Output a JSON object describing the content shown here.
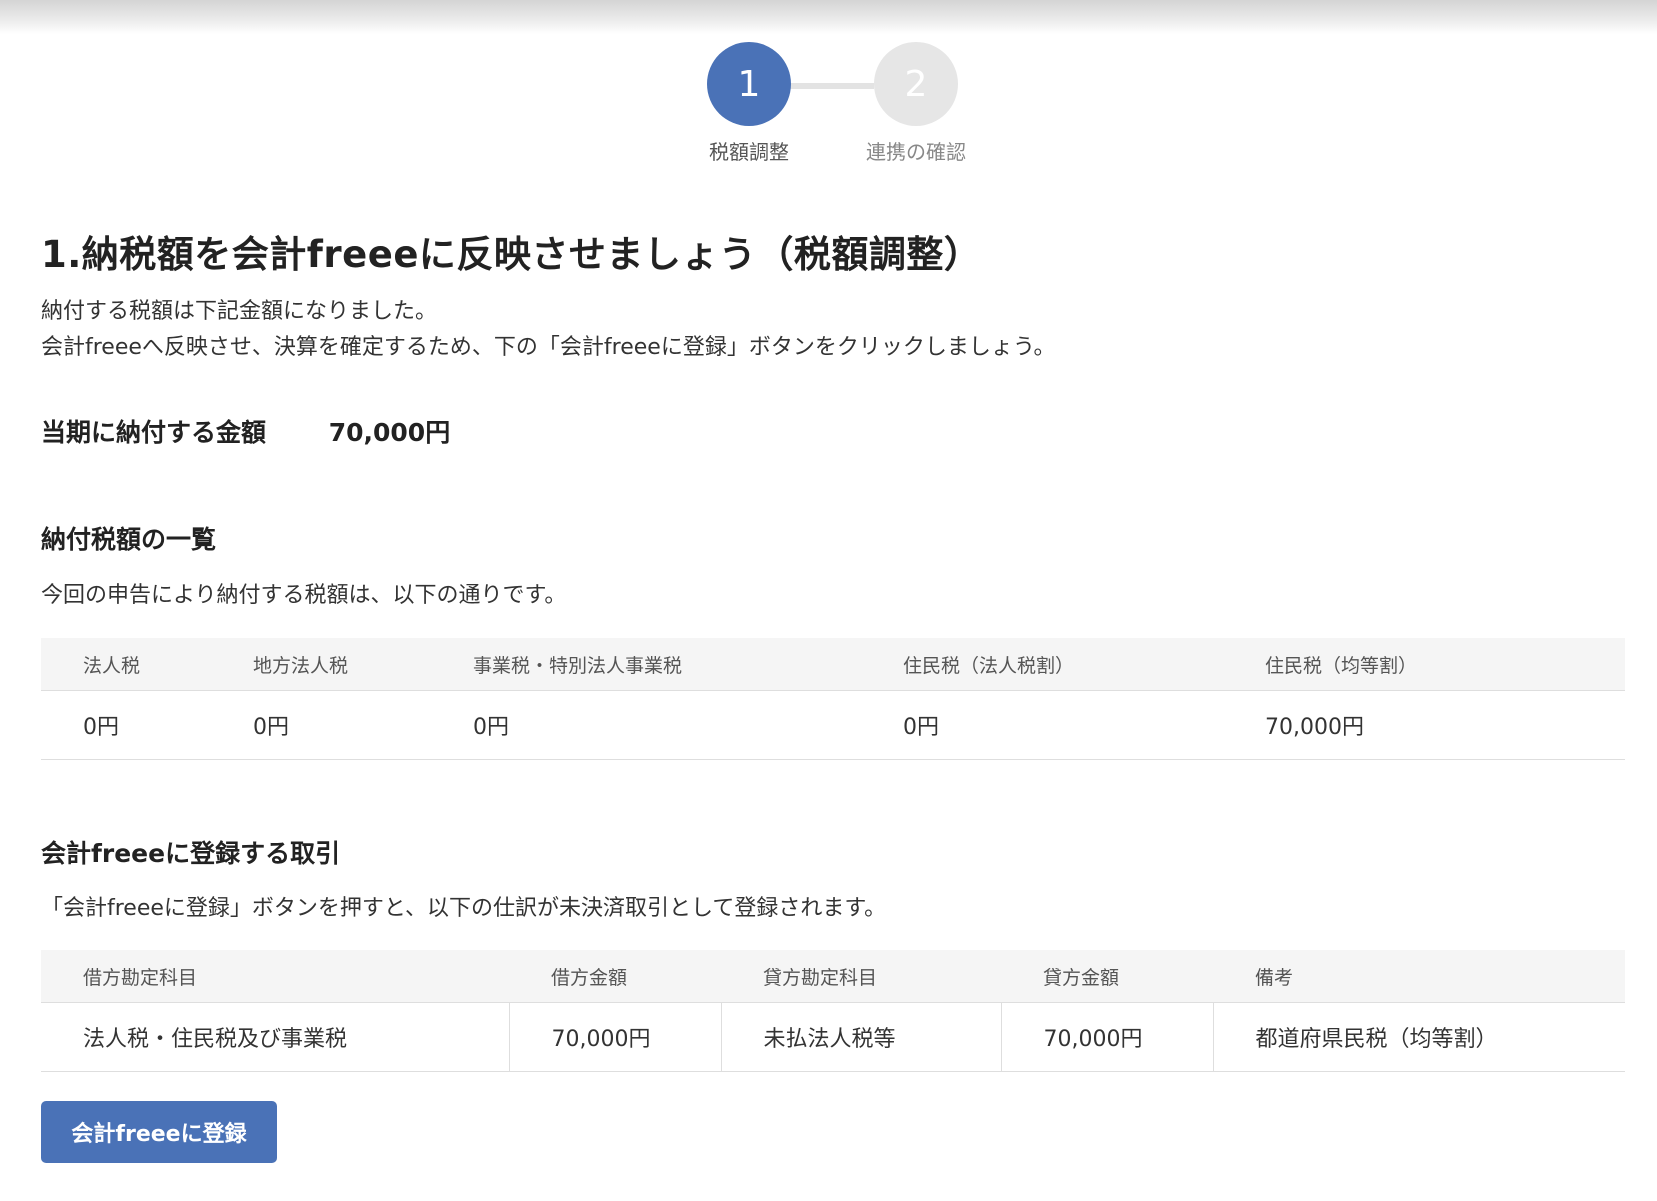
{
  "stepper": {
    "steps": [
      {
        "number": "1",
        "label": "税額調整"
      },
      {
        "number": "2",
        "label": "連携の確認"
      }
    ]
  },
  "page_title": "1.納税額を会計freeeに反映させましょう（税額調整）",
  "intro": {
    "line1": "納付する税額は下記金額になりました。",
    "line2": "会計freeeへ反映させ、決算を確定するため、下の「会計freeeに登録」ボタンをクリックしましょう。"
  },
  "total": {
    "label": "当期に納付する金額",
    "amount": "70,000円"
  },
  "tax_list": {
    "title": "納付税額の一覧",
    "description": "今回の申告により納付する税額は、以下の通りです。",
    "headers": [
      "法人税",
      "地方法人税",
      "事業税・特別法人事業税",
      "住民税（法人税割）",
      "住民税（均等割）"
    ],
    "values": [
      "0円",
      "0円",
      "0円",
      "0円",
      "70,000円"
    ]
  },
  "journal": {
    "title": "会計freeeに登録する取引",
    "description": "「会計freeeに登録」ボタンを押すと、以下の仕訳が未決済取引として登録されます。",
    "headers": [
      "借方勘定科目",
      "借方金額",
      "貸方勘定科目",
      "貸方金額",
      "備考"
    ],
    "row": [
      "法人税・住民税及び事業税",
      "70,000円",
      "未払法人税等",
      "70,000円",
      "都道府県民税（均等割）"
    ]
  },
  "register_button": "会計freeeに登録",
  "colors": {
    "accent": "#4a72b7",
    "inactive_step": "#e6e6e6"
  }
}
